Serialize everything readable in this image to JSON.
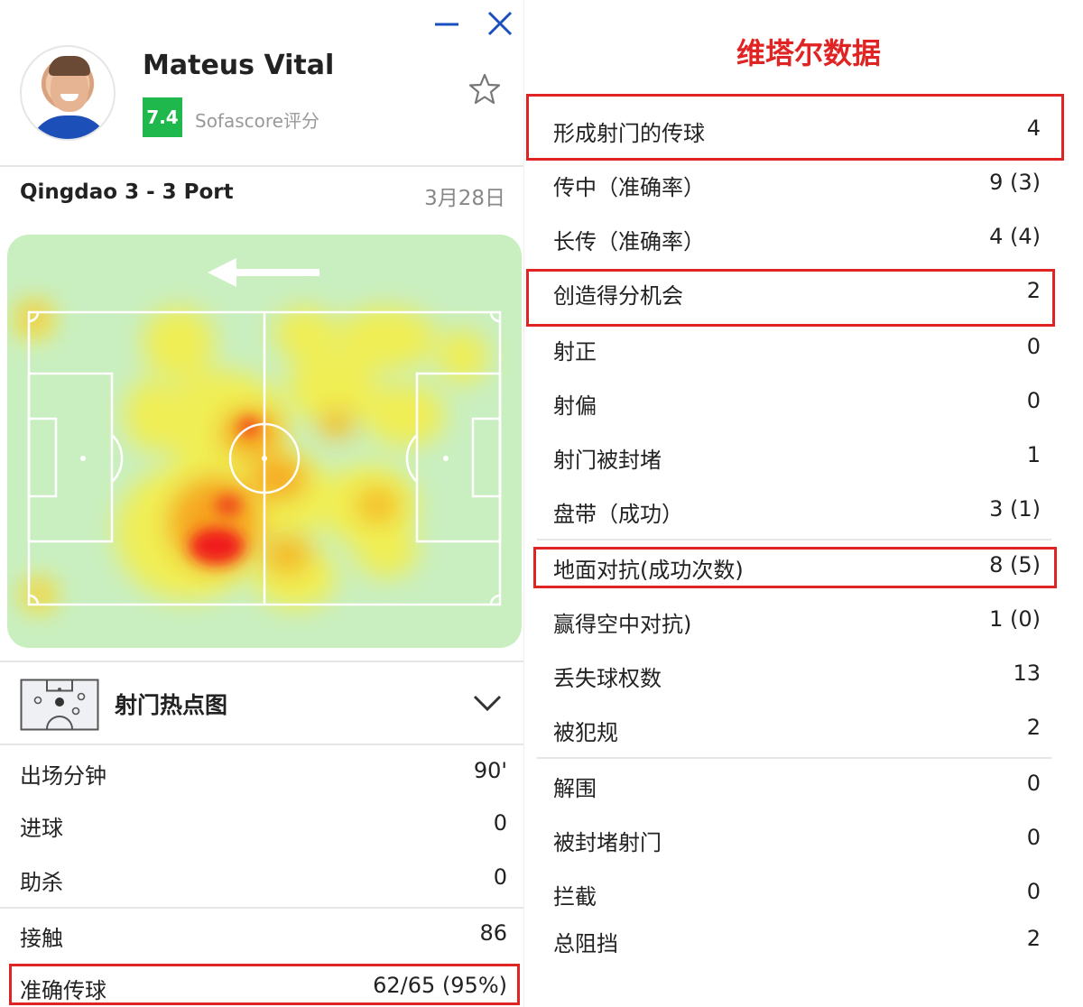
{
  "window": {
    "minimize_icon": "minimize-icon",
    "close_icon": "close-icon"
  },
  "player": {
    "name": "Mateus Vital",
    "rating": "7.4",
    "rating_source": "Sofascore评分",
    "rating_color": "#1fb84c"
  },
  "match": {
    "teams": "Qingdao 3 - 3 Port",
    "date": "3月28日"
  },
  "heatmap": {
    "attack_direction": "left"
  },
  "shotmap": {
    "label": "射门热点图"
  },
  "left_stats": [
    {
      "label": "出场分钟",
      "value": "90'"
    },
    {
      "label": "进球",
      "value": "0"
    },
    {
      "label": "助杀",
      "value": "0"
    },
    {
      "label": "接触",
      "value": "86"
    },
    {
      "label": "准确传球",
      "value": "62/65 (95%)"
    }
  ],
  "right_panel": {
    "title": "维塔尔数据",
    "title_color": "#e02424",
    "stats": [
      {
        "label": "形成射门的传球",
        "value": "4"
      },
      {
        "label": "传中（准确率）",
        "value": "9 (3)"
      },
      {
        "label": "长传（准确率）",
        "value": "4 (4)"
      },
      {
        "label": "创造得分机会",
        "value": "2"
      },
      {
        "label": "射正",
        "value": "0"
      },
      {
        "label": "射偏",
        "value": "0"
      },
      {
        "label": "射门被封堵",
        "value": "1"
      },
      {
        "label": "盘带（成功）",
        "value": "3 (1)"
      },
      {
        "label": "地面对抗(成功次数)",
        "value": "8 (5)"
      },
      {
        "label": "赢得空中对抗)",
        "value": "1 (0)"
      },
      {
        "label": "丢失球权数",
        "value": "13"
      },
      {
        "label": "被犯规",
        "value": "2"
      },
      {
        "label": "解围",
        "value": "0"
      },
      {
        "label": "被封堵射门",
        "value": "0"
      },
      {
        "label": "拦截",
        "value": "0"
      },
      {
        "label": "总阻挡",
        "value": "2"
      }
    ]
  },
  "highlight_color": "#e02424"
}
